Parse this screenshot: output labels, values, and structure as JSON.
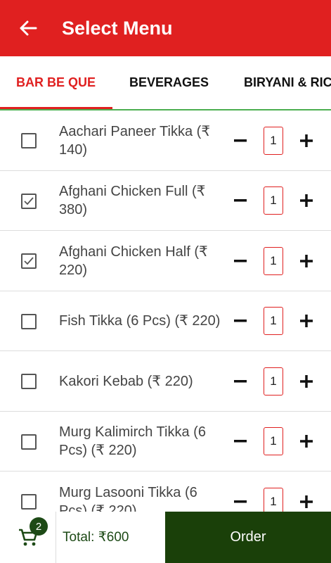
{
  "appbar": {
    "title": "Select Menu",
    "color": "#e02020"
  },
  "tabs": [
    {
      "label": "BAR BE QUE",
      "active": true
    },
    {
      "label": "BEVERAGES",
      "active": false
    },
    {
      "label": "BIRYANI & RIC",
      "active": false
    }
  ],
  "items": [
    {
      "name": "Aachari Paneer Tikka (₹ 140)",
      "checked": false,
      "qty": "1"
    },
    {
      "name": "Afghani Chicken Full (₹ 380)",
      "checked": true,
      "qty": "1"
    },
    {
      "name": "Afghani Chicken Half (₹ 220)",
      "checked": true,
      "qty": "1"
    },
    {
      "name": "Fish Tikka (6 Pcs) (₹ 220)",
      "checked": false,
      "qty": "1"
    },
    {
      "name": "Kakori Kebab (₹ 220)",
      "checked": false,
      "qty": "1"
    },
    {
      "name": "Murg Kalimirch Tikka (6 Pcs) (₹ 220)",
      "checked": false,
      "qty": "1"
    },
    {
      "name": "Murg Lasooni Tikka (6 Pcs) (₹ 220)",
      "checked": false,
      "qty": "1"
    }
  ],
  "cart": {
    "icon": "cart-icon",
    "count": "2"
  },
  "total": "Total: ₹600",
  "order_label": "Order",
  "colors": {
    "primary": "#e02020",
    "order_bg": "#1a4009",
    "tab_divider": "#4caf50"
  }
}
